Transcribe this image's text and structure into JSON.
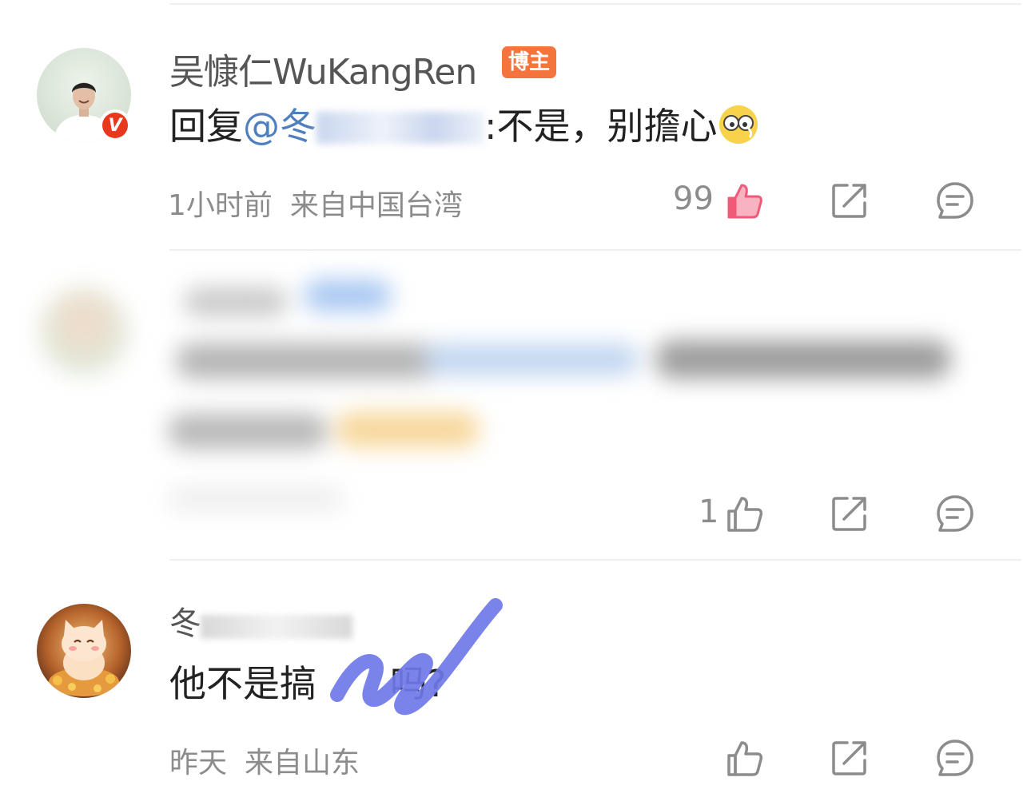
{
  "comments": [
    {
      "username": "吴慷仁WuKangRen",
      "role_badge": "博主",
      "verified_badge": "V",
      "reply_prefix": "回复",
      "mention": "@冬",
      "text": ":不是，别擔心",
      "emoji": "glasses-emoji",
      "time": "1小时前",
      "location": "来自中国台湾",
      "like_count": "99",
      "liked": true
    },
    {
      "blurred": true,
      "like_count": "1",
      "liked": false
    },
    {
      "username_visible": "冬",
      "text_start": "他不是搞",
      "text_end": "吗?",
      "time": "昨天",
      "location": "来自山东",
      "like_count": "",
      "liked": false
    }
  ],
  "icons": {
    "like": "thumbs-up-icon",
    "share": "share-icon",
    "comment": "comment-icon"
  },
  "colors": {
    "like_active": "#f05a78",
    "mention": "#4f7fbf",
    "role_badge": "#f4743d",
    "verified": "#e8381d",
    "scribble": "#6f78e8"
  }
}
